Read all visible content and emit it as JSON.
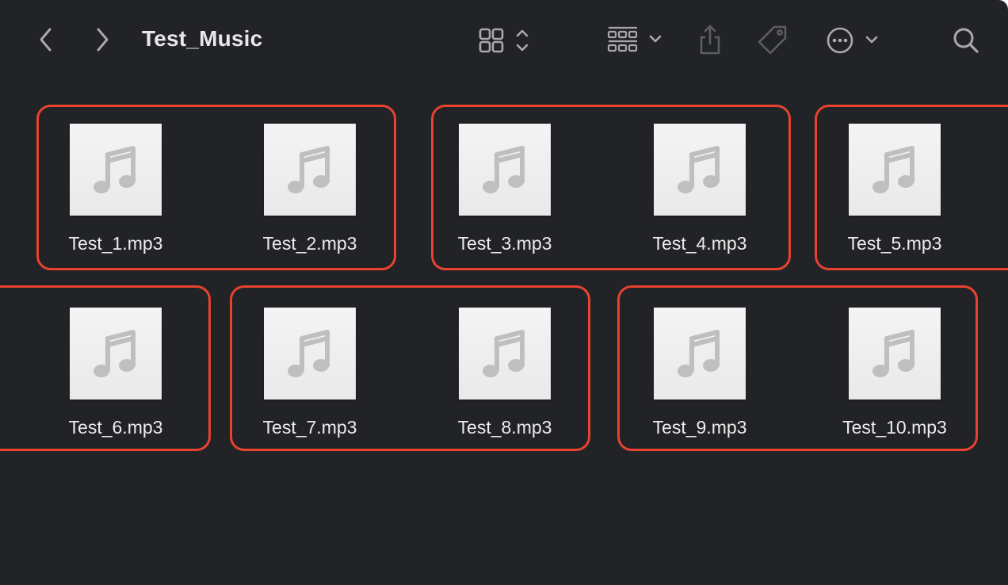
{
  "window": {
    "title": "Test_Music",
    "accent_color": "#e7432f",
    "background_color": "#222326"
  },
  "toolbar": {
    "back_icon": "chevron-left-icon",
    "forward_icon": "chevron-right-icon",
    "view_mode_icon": "grid-view-icon",
    "group_icon": "group-by-icon",
    "share_icon": "share-icon",
    "tag_icon": "tag-icon",
    "more_icon": "ellipsis-circle-icon",
    "search_icon": "search-icon"
  },
  "files": [
    {
      "name": "Test_1.mp3",
      "icon": "music-note-icon"
    },
    {
      "name": "Test_2.mp3",
      "icon": "music-note-icon"
    },
    {
      "name": "Test_3.mp3",
      "icon": "music-note-icon"
    },
    {
      "name": "Test_4.mp3",
      "icon": "music-note-icon"
    },
    {
      "name": "Test_5.mp3",
      "icon": "music-note-icon"
    },
    {
      "name": "Test_6.mp3",
      "icon": "music-note-icon"
    },
    {
      "name": "Test_7.mp3",
      "icon": "music-note-icon"
    },
    {
      "name": "Test_8.mp3",
      "icon": "music-note-icon"
    },
    {
      "name": "Test_9.mp3",
      "icon": "music-note-icon"
    },
    {
      "name": "Test_10.mp3",
      "icon": "music-note-icon"
    }
  ]
}
